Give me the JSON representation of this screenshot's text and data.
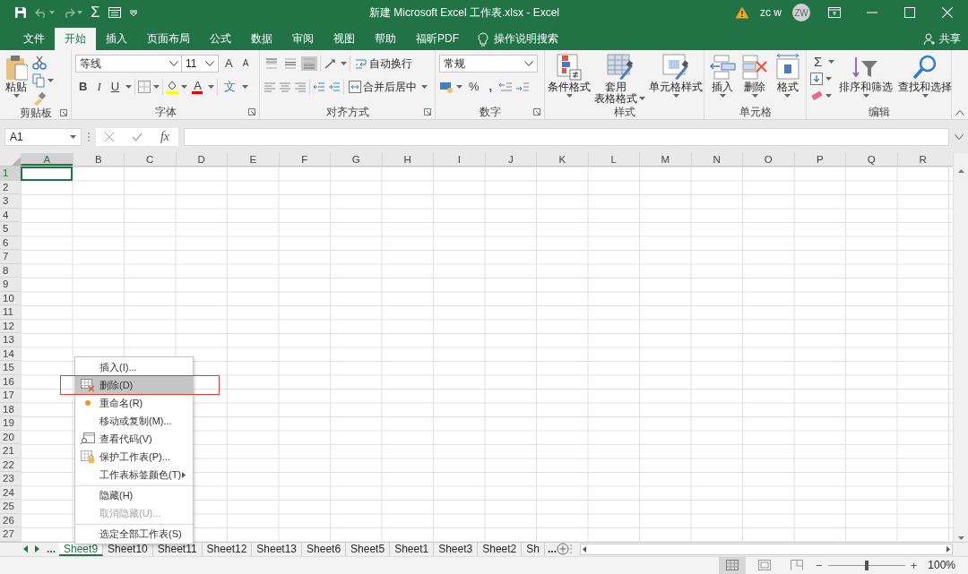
{
  "window": {
    "title": "新建 Microsoft Excel 工作表.xlsx  -  Excel",
    "user": "zc w",
    "avatar": "ZW"
  },
  "quick_access": {
    "sum": "Σ",
    "undo_disabled": true,
    "redo_disabled": true
  },
  "ribbon_tabs": [
    {
      "label": "文件",
      "selected": false
    },
    {
      "label": "开始",
      "selected": true
    },
    {
      "label": "插入",
      "selected": false
    },
    {
      "label": "页面布局",
      "selected": false
    },
    {
      "label": "公式",
      "selected": false
    },
    {
      "label": "数据",
      "selected": false
    },
    {
      "label": "审阅",
      "selected": false
    },
    {
      "label": "视图",
      "selected": false
    },
    {
      "label": "帮助",
      "selected": false
    },
    {
      "label": "福昕PDF",
      "selected": false
    }
  ],
  "tell_me": "操作说明搜索",
  "share": "共享",
  "clipboard": {
    "label": "剪贴板",
    "paste": "粘贴"
  },
  "font": {
    "label": "字体",
    "family": "等线",
    "size": "11",
    "grow": "A",
    "shrink": "A",
    "bold": "B",
    "italic": "I",
    "underline": "U",
    "font_color": "A",
    "phonetic": "文"
  },
  "alignment": {
    "label": "对齐方式",
    "vertical": [
      {
        "selected": false
      },
      {
        "selected": false
      },
      {
        "selected": true
      }
    ],
    "wrap_text": "自动换行",
    "merge_center": "合并后居中"
  },
  "number": {
    "label": "数字",
    "format": "常规",
    "percent": "%",
    "comma": ","
  },
  "styles": {
    "label": "样式",
    "buttons": [
      {
        "kind": "conditional",
        "lines": [
          "条件格式"
        ]
      },
      {
        "kind": "table",
        "lines": [
          "套用",
          "表格格式"
        ]
      },
      {
        "kind": "cellstyle",
        "lines": [
          "单元格样式"
        ]
      }
    ]
  },
  "cells": {
    "label": "单元格",
    "buttons": [
      {
        "kind": "insert",
        "label": "插入"
      },
      {
        "kind": "delete",
        "label": "删除"
      },
      {
        "kind": "format",
        "label": "格式"
      }
    ]
  },
  "editing": {
    "label": "编辑",
    "sum": "Σ",
    "buttons": [
      {
        "kind": "sort",
        "label": "排序和筛选"
      },
      {
        "kind": "find",
        "label": "查找和选择"
      }
    ]
  },
  "formula_bar": {
    "name_box": "A1",
    "function": "fx"
  },
  "grid": {
    "columns": [
      {
        "label": "A",
        "selected": true
      },
      {
        "label": "B",
        "selected": false
      },
      {
        "label": "C",
        "selected": false
      },
      {
        "label": "D",
        "selected": false
      },
      {
        "label": "E",
        "selected": false
      },
      {
        "label": "F",
        "selected": false
      },
      {
        "label": "G",
        "selected": false
      },
      {
        "label": "H",
        "selected": false
      },
      {
        "label": "I",
        "selected": false
      },
      {
        "label": "J",
        "selected": false
      },
      {
        "label": "K",
        "selected": false
      },
      {
        "label": "L",
        "selected": false
      },
      {
        "label": "M",
        "selected": false
      },
      {
        "label": "N",
        "selected": false
      },
      {
        "label": "O",
        "selected": false
      },
      {
        "label": "P",
        "selected": false
      },
      {
        "label": "Q",
        "selected": false
      },
      {
        "label": "R",
        "selected": false
      }
    ],
    "rows": [
      {
        "label": "1",
        "selected": true
      },
      {
        "label": "2",
        "selected": false
      },
      {
        "label": "3",
        "selected": false
      },
      {
        "label": "4",
        "selected": false
      },
      {
        "label": "5",
        "selected": false
      },
      {
        "label": "6",
        "selected": false
      },
      {
        "label": "7",
        "selected": false
      },
      {
        "label": "8",
        "selected": false
      },
      {
        "label": "9",
        "selected": false
      },
      {
        "label": "10",
        "selected": false
      },
      {
        "label": "11",
        "selected": false
      },
      {
        "label": "12",
        "selected": false
      },
      {
        "label": "13",
        "selected": false
      },
      {
        "label": "14",
        "selected": false
      },
      {
        "label": "15",
        "selected": false
      },
      {
        "label": "16",
        "selected": false
      },
      {
        "label": "17",
        "selected": false
      },
      {
        "label": "18",
        "selected": false
      },
      {
        "label": "19",
        "selected": false
      },
      {
        "label": "20",
        "selected": false
      },
      {
        "label": "21",
        "selected": false
      },
      {
        "label": "22",
        "selected": false
      },
      {
        "label": "23",
        "selected": false
      },
      {
        "label": "24",
        "selected": false
      },
      {
        "label": "25",
        "selected": false
      },
      {
        "label": "26",
        "selected": false
      },
      {
        "label": "27",
        "selected": false
      }
    ]
  },
  "context_menu": {
    "items": [
      {
        "label": "插入(I)...",
        "kind": "plain",
        "selected": false,
        "disabled": false,
        "annotated": false,
        "divider_above": false
      },
      {
        "label": "删除(D)",
        "kind": "delete",
        "selected": true,
        "disabled": false,
        "annotated": true,
        "divider_above": false
      },
      {
        "label": "重命名(R)",
        "kind": "rename",
        "selected": false,
        "disabled": false,
        "annotated": false,
        "divider_above": false
      },
      {
        "label": "移动或复制(M)...",
        "kind": "plain",
        "selected": false,
        "disabled": false,
        "annotated": false,
        "divider_above": false
      },
      {
        "label": "查看代码(V)",
        "kind": "code",
        "selected": false,
        "disabled": false,
        "annotated": false,
        "divider_above": false
      },
      {
        "label": "保护工作表(P)...",
        "kind": "protect",
        "selected": false,
        "disabled": false,
        "annotated": false,
        "divider_above": false
      },
      {
        "label": "工作表标签颜色(T)",
        "kind": "submenu",
        "selected": false,
        "disabled": false,
        "annotated": false,
        "divider_above": false
      },
      {
        "label": "隐藏(H)",
        "kind": "plain",
        "selected": false,
        "disabled": false,
        "annotated": false,
        "divider_above": true
      },
      {
        "label": "取消隐藏(U)...",
        "kind": "plain",
        "selected": false,
        "disabled": true,
        "annotated": false,
        "divider_above": false
      },
      {
        "label": "选定全部工作表(S)",
        "kind": "plain",
        "selected": false,
        "disabled": false,
        "annotated": false,
        "divider_above": true
      }
    ]
  },
  "sheet_tabs": {
    "nav_more": "...",
    "tabs": [
      {
        "label": "Sheet9",
        "selected": true
      },
      {
        "label": "Sheet10",
        "selected": false
      },
      {
        "label": "Sheet11",
        "selected": false
      },
      {
        "label": "Sheet12",
        "selected": false
      },
      {
        "label": "Sheet13",
        "selected": false
      },
      {
        "label": "Sheet6",
        "selected": false
      },
      {
        "label": "Sheet5",
        "selected": false
      },
      {
        "label": "Sheet1",
        "selected": false
      },
      {
        "label": "Sheet3",
        "selected": false
      },
      {
        "label": "Sheet2",
        "selected": false
      },
      {
        "label": "Sh",
        "selected": false
      }
    ],
    "more": "..."
  },
  "status_bar": {
    "views": [
      {
        "kind": "normal",
        "selected": true
      },
      {
        "kind": "page-layout",
        "selected": false
      },
      {
        "kind": "page-break",
        "selected": false
      }
    ],
    "zoom_out": "−",
    "zoom_in": "+",
    "zoom": {
      "level": 0.5
    },
    "zoom_text": "100%"
  }
}
